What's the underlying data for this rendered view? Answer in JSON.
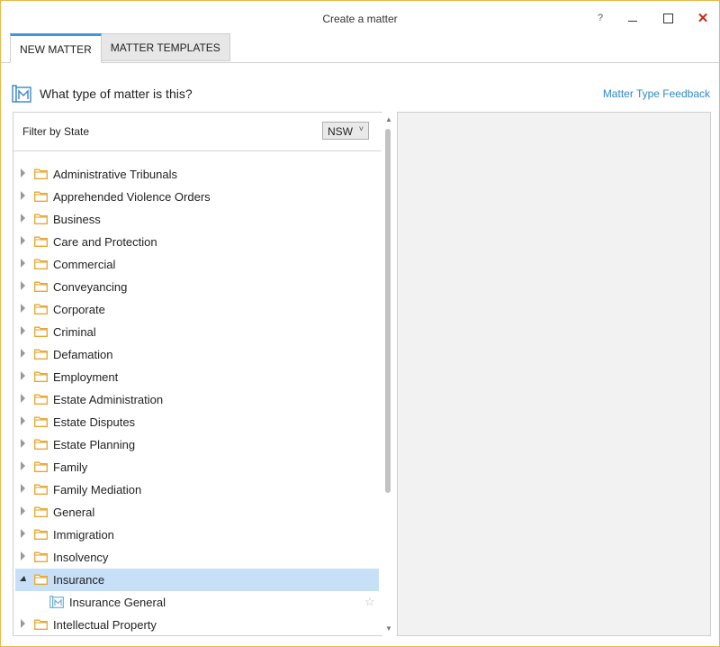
{
  "window": {
    "title": "Create a matter",
    "help_label": "?",
    "close_label": "✕"
  },
  "tabs": [
    {
      "label": "NEW MATTER",
      "active": true
    },
    {
      "label": "MATTER TEMPLATES",
      "active": false
    }
  ],
  "header": {
    "question": "What type of matter is this?",
    "feedback_link": "Matter Type Feedback",
    "icon": "matter-icon"
  },
  "filter": {
    "label": "Filter by State",
    "selected_state": "NSW",
    "dropdown_icon": "chevron-down-icon"
  },
  "tree": {
    "items": [
      {
        "label": "Administrative Tribunals"
      },
      {
        "label": "Apprehended Violence Orders"
      },
      {
        "label": "Business"
      },
      {
        "label": "Care and Protection"
      },
      {
        "label": "Commercial"
      },
      {
        "label": "Conveyancing"
      },
      {
        "label": "Corporate"
      },
      {
        "label": "Criminal"
      },
      {
        "label": "Defamation"
      },
      {
        "label": "Employment"
      },
      {
        "label": "Estate Administration"
      },
      {
        "label": "Estate Disputes"
      },
      {
        "label": "Estate Planning"
      },
      {
        "label": "Family"
      },
      {
        "label": "Family Mediation"
      },
      {
        "label": "General"
      },
      {
        "label": "Immigration"
      },
      {
        "label": "Insolvency"
      },
      {
        "label": "Insurance",
        "expanded": true,
        "selected": true
      },
      {
        "label": "Insurance General",
        "leaf": true
      },
      {
        "label": "Intellectual Property"
      }
    ]
  },
  "colors": {
    "accent": "#3b97e0",
    "link": "#2f87c9",
    "folder": "#e8a630",
    "selection": "#c7dff7",
    "close": "#c42b1c"
  }
}
